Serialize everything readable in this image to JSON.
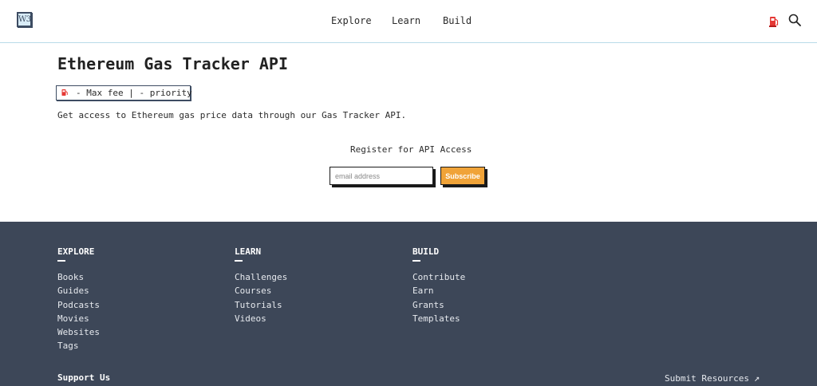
{
  "header": {
    "logo_text": "W3",
    "nav": [
      "Explore",
      "Learn",
      "Build"
    ],
    "icons": [
      "gas-pump-icon",
      "search-icon"
    ]
  },
  "main": {
    "title": "Ethereum Gas Tracker API",
    "gas_display": "- Max fee | - priority",
    "intro": "Get access to Ethereum gas price data through our Gas Tracker API.",
    "register_label": "Register for API Access",
    "email_placeholder": "email address",
    "subscribe_label": "Subscribe"
  },
  "footer": {
    "columns": [
      {
        "heading": "EXPLORE",
        "links": [
          "Books",
          "Guides",
          "Podcasts",
          "Movies",
          "Websites",
          "Tags"
        ]
      },
      {
        "heading": "LEARN",
        "links": [
          "Challenges",
          "Courses",
          "Tutorials",
          "Videos"
        ]
      },
      {
        "heading": "BUILD",
        "links": [
          "Contribute",
          "Earn",
          "Grants",
          "Templates"
        ]
      }
    ],
    "support_us": "Support Us",
    "submit_resources": "Submit Resources",
    "submit_icon": "arrow-up-right-icon"
  },
  "colors": {
    "accent": "#f0a338",
    "footer_bg": "#3d4758",
    "pump_red": "#e53935",
    "header_border": "#b9dbe8"
  }
}
